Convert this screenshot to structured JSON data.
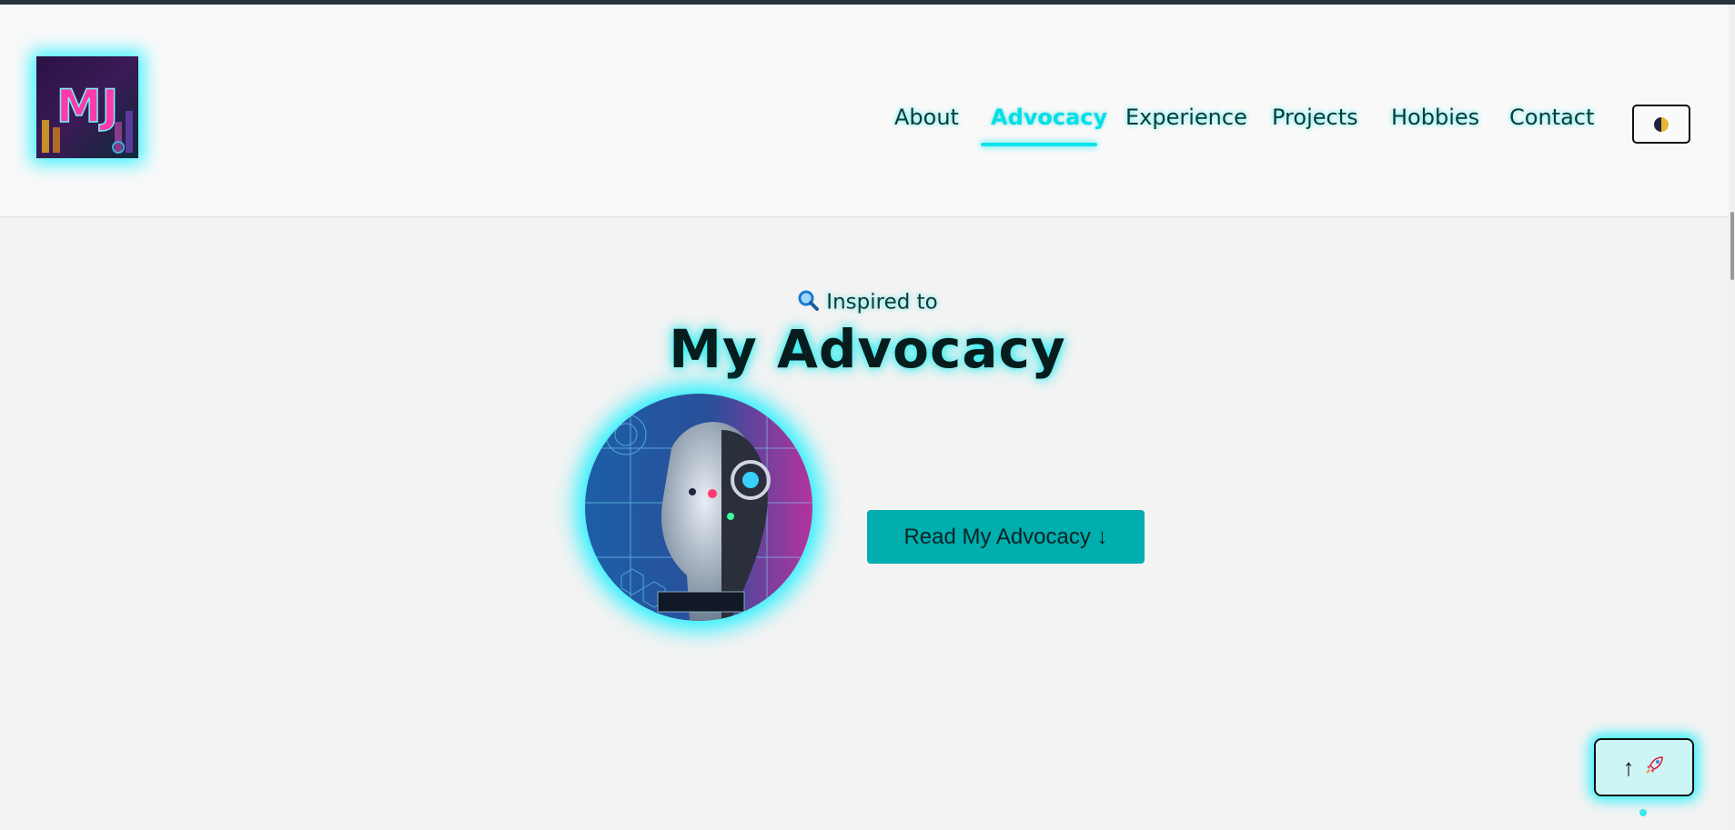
{
  "logo": {
    "text": "MJ",
    "icon": "mj-logo-icon"
  },
  "nav": {
    "items": [
      {
        "label": "About"
      },
      {
        "label": "Advocacy",
        "active": true
      },
      {
        "label": "Experience"
      },
      {
        "label": "Projects"
      },
      {
        "label": "Hobbies"
      },
      {
        "label": "Contact"
      }
    ],
    "theme_toggle_icon": "half-circle-theme-icon"
  },
  "hero": {
    "eyebrow_icon": "magnifier-icon",
    "eyebrow": "Inspired to",
    "title": "My Advocacy",
    "avatar_icon": "ai-robot-portrait",
    "cta_label": "Read My Advocacy ↓"
  },
  "back_to_top": {
    "arrow": "↑",
    "icon": "rocket-icon"
  },
  "colors": {
    "accent": "#00e3ea",
    "cta_bg": "#00adaf",
    "header_bg": "#f9f9f9",
    "page_bg": "#f3f3f3",
    "text": "#0d3b3b"
  }
}
